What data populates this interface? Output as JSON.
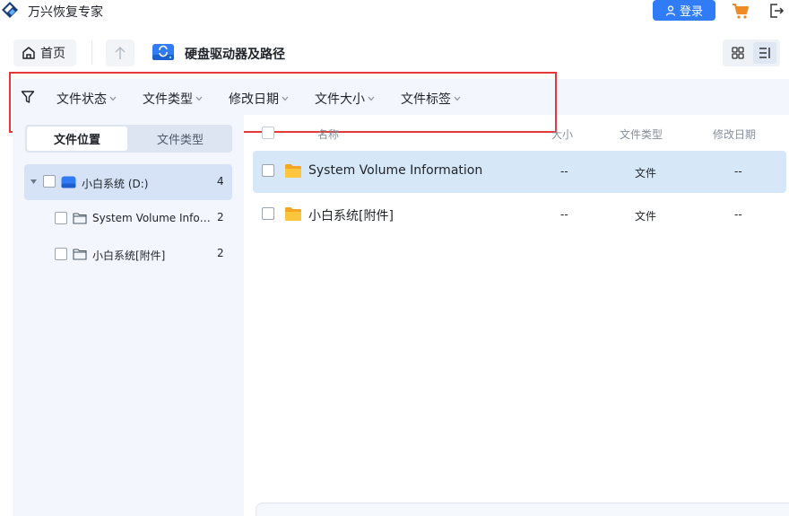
{
  "app": {
    "title": "万兴恢复专家",
    "login_label": "登录",
    "accent": "#2f7cf6"
  },
  "nav": {
    "home_label": "首页",
    "path_title": "硬盘驱动器及路径"
  },
  "filters": [
    {
      "label": "文件状态"
    },
    {
      "label": "文件类型"
    },
    {
      "label": "修改日期"
    },
    {
      "label": "文件大小"
    },
    {
      "label": "文件标签"
    }
  ],
  "left_tabs": {
    "location": "文件位置",
    "type": "文件类型"
  },
  "tree": {
    "root": {
      "label": "小白系统 (D:)",
      "count": "4"
    },
    "children": [
      {
        "label": "System Volume Infor...",
        "count": "2"
      },
      {
        "label": "小白系统[附件]",
        "count": "2"
      }
    ]
  },
  "list": {
    "columns": {
      "name": "名称",
      "size": "大小",
      "type": "文件类型",
      "modified": "修改日期"
    },
    "rows": [
      {
        "name": "System Volume Information",
        "size": "--",
        "type": "文件",
        "modified": "--"
      },
      {
        "name": "小白系统[附件]",
        "size": "--",
        "type": "文件",
        "modified": "--"
      }
    ]
  }
}
